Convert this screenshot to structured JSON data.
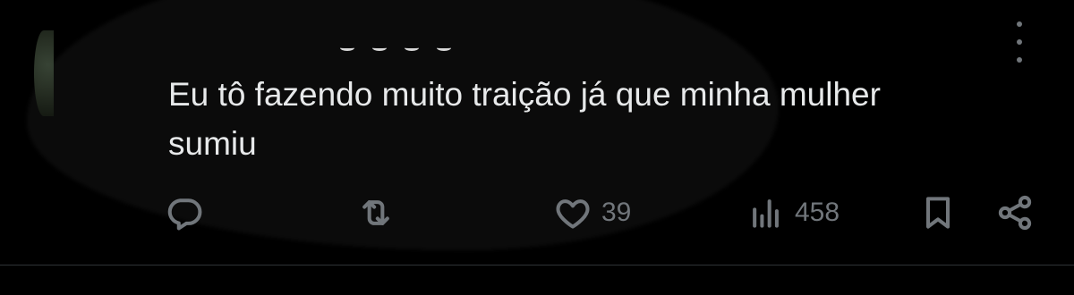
{
  "tweet": {
    "text_line_1": "Eu tô fazendo muito traição já que minha mulher",
    "text_line_2": "sumiu"
  },
  "actions": {
    "reply": {
      "icon": "reply-icon"
    },
    "retweet": {
      "icon": "retweet-icon"
    },
    "like": {
      "icon": "heart-icon",
      "count": "39"
    },
    "views": {
      "icon": "views-icon",
      "count": "458"
    },
    "bookmark": {
      "icon": "bookmark-icon"
    },
    "share": {
      "icon": "share-icon"
    }
  },
  "colors": {
    "background": "#000000",
    "text": "#e7e9ea",
    "secondary": "#71767b",
    "divider": "#2f3336"
  }
}
